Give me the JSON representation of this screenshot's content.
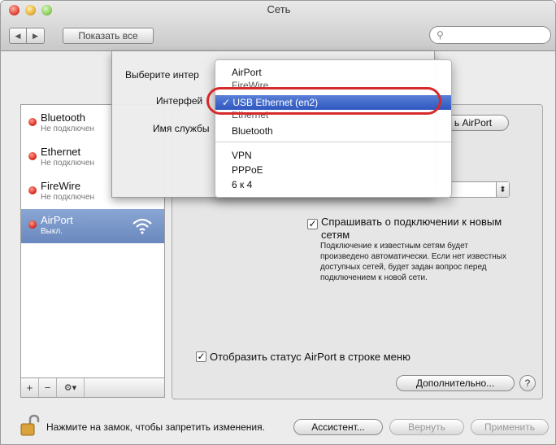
{
  "window": {
    "title": "Сеть"
  },
  "toolbar": {
    "show_all": "Показать все",
    "back_glyph": "◀",
    "forward_glyph": "▶",
    "search_glyph": "⚲"
  },
  "services": [
    {
      "name": "Bluetooth",
      "status": "Не подключен"
    },
    {
      "name": "Ethernet",
      "status": "Не подключен"
    },
    {
      "name": "FireWire",
      "status": "Не подключен"
    },
    {
      "name": "AirPort",
      "status": "Выкл."
    }
  ],
  "list_controls": {
    "add": "+",
    "remove": "−",
    "gear": "⚙▾"
  },
  "panel": {
    "airport_button": "ь AirPort",
    "ask_checkbox_label_1": "Спрашивать о подключении к новым",
    "ask_checkbox_label_2": "сетям",
    "ask_note": "Подключение к известным сетям будет произведено автоматически. Если нет известных доступных сетей, будет задан вопрос перед подключением к новой сети.",
    "status_checkbox_label": "Отобразить статус AirPort в строке меню",
    "advanced_button": "Дополнительно...",
    "help": "?",
    "checkmark": "✓",
    "select_arrow": "⬍"
  },
  "sheet": {
    "choose_label": "Выберите интер",
    "interface_label": "Интерфей",
    "service_name_label": "Имя службы"
  },
  "menu": {
    "items_top": [
      "AirPort",
      "FireWire"
    ],
    "selected": "✓ USB Ethernet (en2)",
    "items_after": [
      "Ethernet",
      "Bluetooth"
    ],
    "items_ppp": [
      "VPN",
      "PPPoE",
      "6 к 4"
    ]
  },
  "bottom": {
    "lock_text": "Нажмите на замок, чтобы запретить изменения.",
    "assistant": "Ассистент...",
    "revert": "Вернуть",
    "apply": "Применить"
  },
  "colors": {
    "accent": "#2e57c0",
    "annotation_ring": "#d62a2a",
    "status_red": "#d8281c"
  }
}
